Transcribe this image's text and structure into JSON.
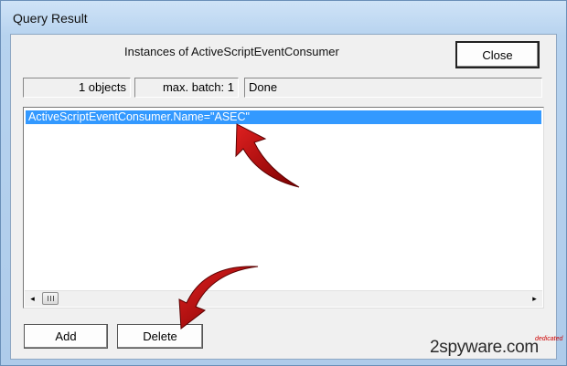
{
  "window": {
    "title": "Query Result"
  },
  "header": {
    "text": "Instances of ActiveScriptEventConsumer"
  },
  "buttons": {
    "close": "Close",
    "add": "Add",
    "delete": "Delete"
  },
  "status": {
    "objects": "1 objects",
    "batch": "max. batch: 1",
    "state": "Done"
  },
  "results": {
    "rows": [
      "ActiveScriptEventConsumer.Name=\"ASEC\""
    ]
  },
  "scrollbar": {
    "left_arrow": "◂",
    "right_arrow": "▸"
  },
  "watermark": {
    "text": "2spyware.com",
    "tag": "dedicated"
  },
  "colors": {
    "selection": "#3399ff",
    "arrow": "#b00000"
  }
}
